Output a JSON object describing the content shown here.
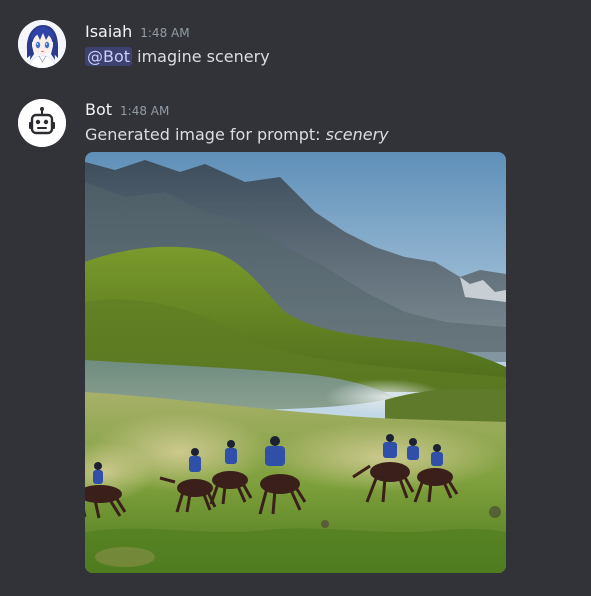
{
  "messages": [
    {
      "username": "Isaiah",
      "timestamp": "1:48 AM",
      "mention": "@Bot",
      "text": "imagine scenery"
    },
    {
      "username": "Bot",
      "timestamp": "1:48 AM",
      "text_prefix": "Generated image for prompt: ",
      "prompt": "scenery"
    }
  ],
  "colors": {
    "background": "#313338",
    "username": "#f2f3f5",
    "timestamp": "#949ba4",
    "message_text": "#dbdee1",
    "mention_bg": "rgba(88,101,242,0.3)",
    "mention_text": "#c9cdfb"
  }
}
